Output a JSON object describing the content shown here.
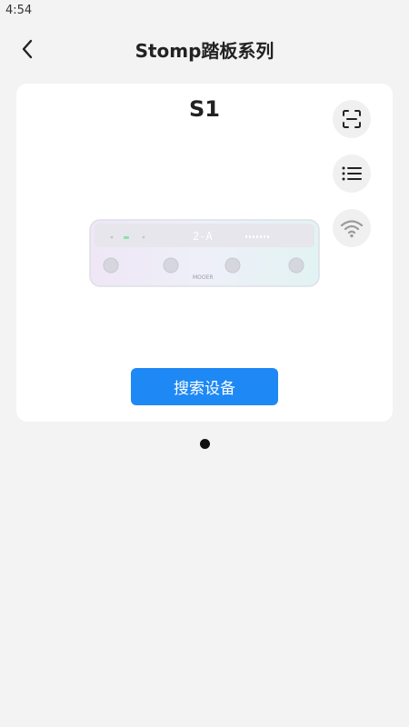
{
  "status_bar": {
    "time": "4:54"
  },
  "header": {
    "title": "Stomp踏板系列"
  },
  "card": {
    "device_name": "S1",
    "device_display": "2-A",
    "device_brand": "MOOER",
    "search_button_label": "搜索设备",
    "side_buttons": [
      {
        "icon": "scan-icon"
      },
      {
        "icon": "list-icon"
      },
      {
        "icon": "wifi-icon"
      }
    ]
  },
  "pagination": {
    "total": 1,
    "active": 1
  }
}
